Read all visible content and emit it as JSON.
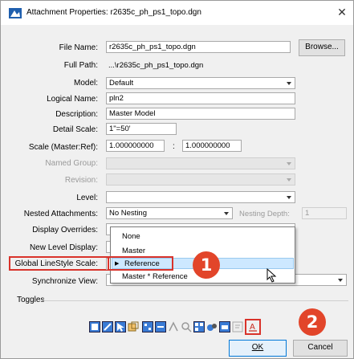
{
  "window": {
    "title": "Attachment Properties: r2635c_ph_ps1_topo.dgn"
  },
  "fields": {
    "file_name": {
      "label": "File Name:",
      "value": "r2635c_ph_ps1_topo.dgn",
      "browse": "Browse..."
    },
    "full_path": {
      "label": "Full Path:",
      "value": "...\\r2635c_ph_ps1_topo.dgn"
    },
    "model": {
      "label": "Model:",
      "value": "Default"
    },
    "logical_name": {
      "label": "Logical Name:",
      "value": "pln2"
    },
    "description": {
      "label": "Description:",
      "value": "Master Model"
    },
    "detail_scale": {
      "label": "Detail Scale:",
      "value": "1\"=50'"
    },
    "scale": {
      "label": "Scale (Master:Ref):",
      "left": "1.000000000",
      "sep": ":",
      "right": "1.000000000"
    },
    "named_group": {
      "label": "Named Group:",
      "value": ""
    },
    "revision": {
      "label": "Revision:",
      "value": ""
    },
    "level": {
      "label": "Level:",
      "value": ""
    },
    "nested_attachments": {
      "label": "Nested Attachments:",
      "value": "No Nesting",
      "depth_label": "Nesting Depth:",
      "depth_value": "1"
    },
    "display_overrides": {
      "label": "Display Overrides:"
    },
    "new_level_display": {
      "label": "New Level Display:"
    },
    "global_linestyle_scale": {
      "label": "Global LineStyle Scale:"
    },
    "synchronize_view": {
      "label": "Synchronize View:"
    }
  },
  "dropdown": {
    "items": [
      "None",
      "Master",
      "Reference",
      "Master * Reference"
    ],
    "selected": "Reference"
  },
  "toggles": {
    "label": "Toggles"
  },
  "buttons": {
    "ok": "OK",
    "cancel": "Cancel"
  },
  "callouts": {
    "one": "1",
    "two": "2"
  },
  "colors": {
    "callout": "#e2452a",
    "highlight_box": "#d9332b",
    "selection": "#cde8ff"
  },
  "toolbar_icons": [
    "display-toggle-icon",
    "snap-toggle-icon",
    "locate-toggle-icon",
    "treat-as-element-icon",
    "raster-toggle-icon",
    "ignore-attachment-icon",
    "render-toggle-icon",
    "clip-toggle-icon",
    "views-toggle-icon",
    "color-toggle-icon",
    "print-toggle-icon",
    "annotation-toggle-icon",
    "line-style-toggle-icon"
  ]
}
